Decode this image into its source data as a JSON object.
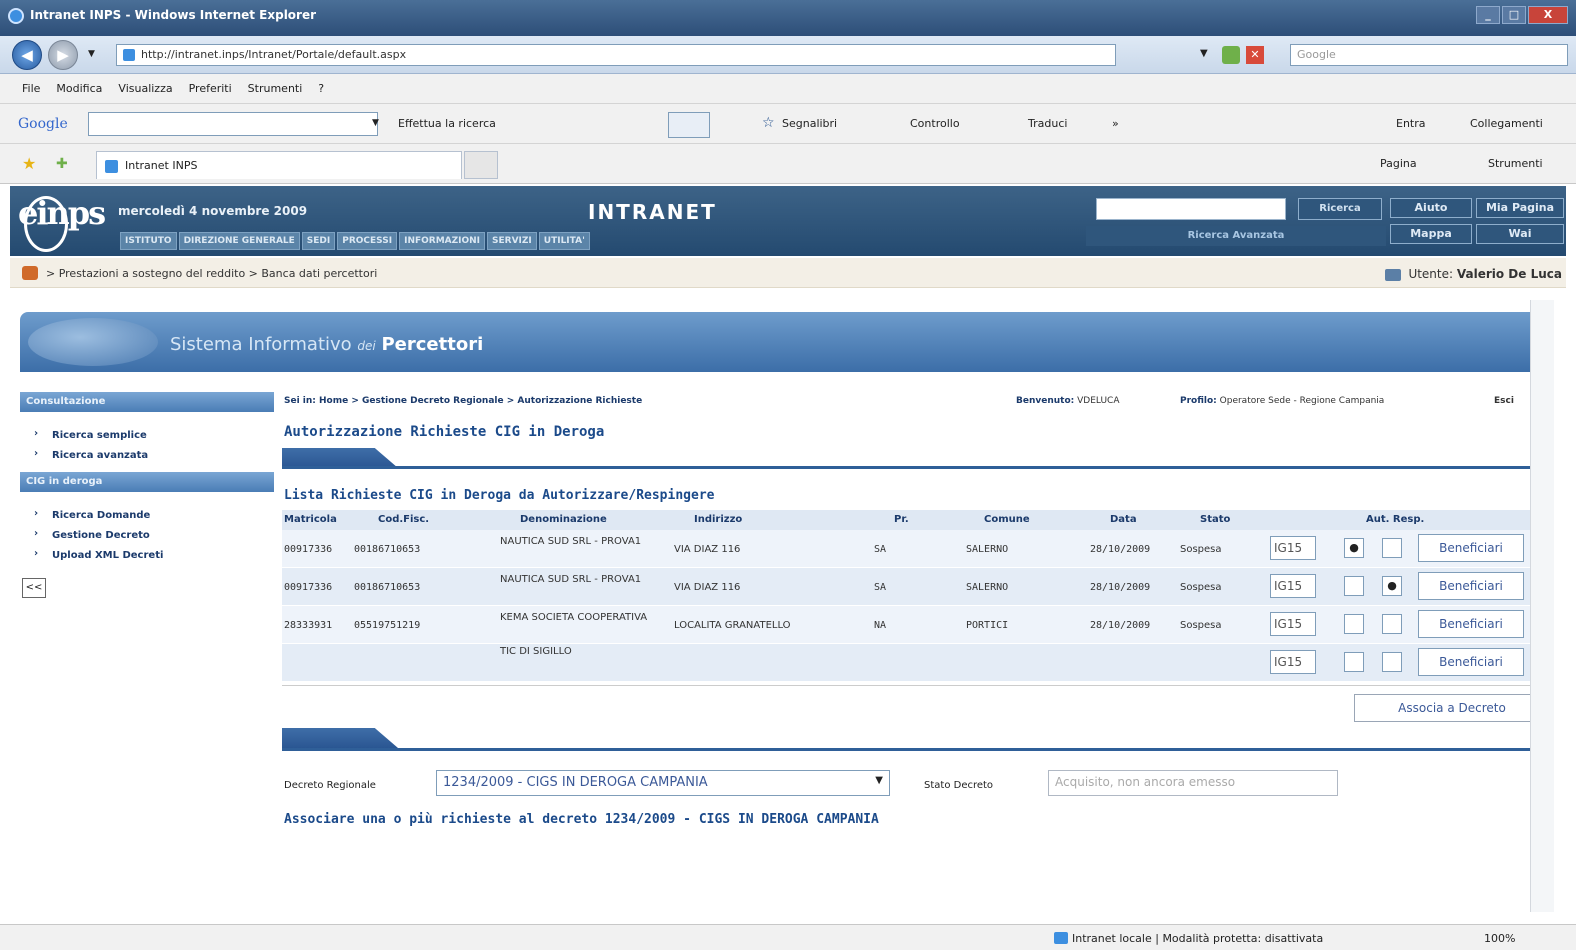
{
  "window": {
    "title": "Intranet INPS - Windows Internet Explorer",
    "url": "http://intranet.inps/Intranet/Portale/default.aspx",
    "search_placeholder": "Google",
    "buttons": [
      "_",
      "□",
      "X"
    ]
  },
  "menu": [
    "File",
    "Modifica",
    "Visualizza",
    "Preferiti",
    "Strumenti",
    "?"
  ],
  "google_toolbar": {
    "logo": "Google",
    "search_btn": "Effettua la ricerca",
    "bookmarks": "Segnalibri",
    "check": "Controllo",
    "translate": "Traduci",
    "more": "»",
    "login": "Entra",
    "links": "Collegamenti"
  },
  "tab": {
    "title": "Intranet INPS",
    "pagina": "Pagina",
    "strumenti": "Strumenti"
  },
  "inps_header": {
    "logo": "einps",
    "date": "mercoledì 4 novembre 2009",
    "title": "INTRANET",
    "nav": [
      "ISTITUTO",
      "DIREZIONE GENERALE",
      "SEDI",
      "PROCESSI",
      "INFORMAZIONI",
      "SERVIZI",
      "UTILITA'"
    ],
    "search_btn": "Ricerca",
    "advanced": "Ricerca Avanzata",
    "aiuto": "Aiuto",
    "mia_pagina": "Mia Pagina",
    "mappa": "Mappa",
    "wai": "Wai"
  },
  "breadcrumb": {
    "text": "> Prestazioni a sostegno del reddito > Banca dati percettori",
    "user_label": "Utente:",
    "user": "Valerio De Luca"
  },
  "banner": {
    "prefix": "Sistema Informativo",
    "dei": "dei",
    "name": "Percettori"
  },
  "sidebar": {
    "section1": "Consultazione",
    "items1": [
      "Ricerca semplice",
      "Ricerca avanzata"
    ],
    "section2": "CIG in deroga",
    "items2": [
      "Ricerca Domande",
      "Gestione Decreto",
      "Upload XML Decreti"
    ],
    "collapse": "<<"
  },
  "main": {
    "crumb": "Sei in: Home > Gestione Decreto Regionale > Autorizzazione Richieste",
    "benvenuto_label": "Benvenuto:",
    "benvenuto": "VDELUCA",
    "profilo_label": "Profilo:",
    "profilo": "Operatore Sede - Regione Campania",
    "esci": "Esci",
    "title": "Autorizzazione Richieste CIG in Deroga",
    "list_title": "Lista Richieste CIG in Deroga da Autorizzare/Respingere",
    "columns": [
      "Matricola",
      "Cod.Fisc.",
      "Denominazione",
      "Indirizzo",
      "Pr.",
      "Comune",
      "Data",
      "Stato",
      "Aut. Resp."
    ],
    "rows": [
      {
        "matricola": "00917336",
        "codfisc": "00186710653",
        "denom": "NAUTICA SUD SRL - PROVA1",
        "indirizzo": "VIA DIAZ 116",
        "pr": "SA",
        "comune": "SALERNO",
        "data": "28/10/2009",
        "stato": "Sospesa",
        "code": "IG15",
        "aut": "●",
        "resp": "",
        "btn": "Beneficiari"
      },
      {
        "matricola": "00917336",
        "codfisc": "00186710653",
        "denom": "NAUTICA SUD SRL - PROVA1",
        "indirizzo": "VIA DIAZ 116",
        "pr": "SA",
        "comune": "SALERNO",
        "data": "28/10/2009",
        "stato": "Sospesa",
        "code": "IG15",
        "aut": "",
        "resp": "●",
        "btn": "Beneficiari"
      },
      {
        "matricola": "28333931",
        "codfisc": "05519751219",
        "denom": "KEMA SOCIETA COOPERATIVA",
        "indirizzo": "LOCALITA GRANATELLO",
        "pr": "NA",
        "comune": "PORTICI",
        "data": "28/10/2009",
        "stato": "Sospesa",
        "code": "IG15",
        "aut": "",
        "resp": "",
        "btn": "Beneficiari"
      },
      {
        "matricola": "",
        "codfisc": "",
        "denom": "TIC DI SIGILLO",
        "indirizzo": "",
        "pr": "",
        "comune": "",
        "data": "",
        "stato": "",
        "code": "IG15",
        "aut": "",
        "resp": "",
        "btn": "Beneficiari"
      }
    ],
    "assoc_btn": "Associa a Decreto",
    "decreto_label": "Decreto Regionale",
    "decreto_value": "1234/2009 - CIGS IN DEROGA CAMPANIA",
    "stato_label": "Stato Decreto",
    "stato_value": "Acquisito, non ancora emesso",
    "assoc_msg": "Associare una o più richieste al decreto 1234/2009 - CIGS IN DEROGA CAMPANIA"
  },
  "statusbar": {
    "zone": "Intranet locale | Modalità protetta: disattivata",
    "zoom": "100%"
  }
}
